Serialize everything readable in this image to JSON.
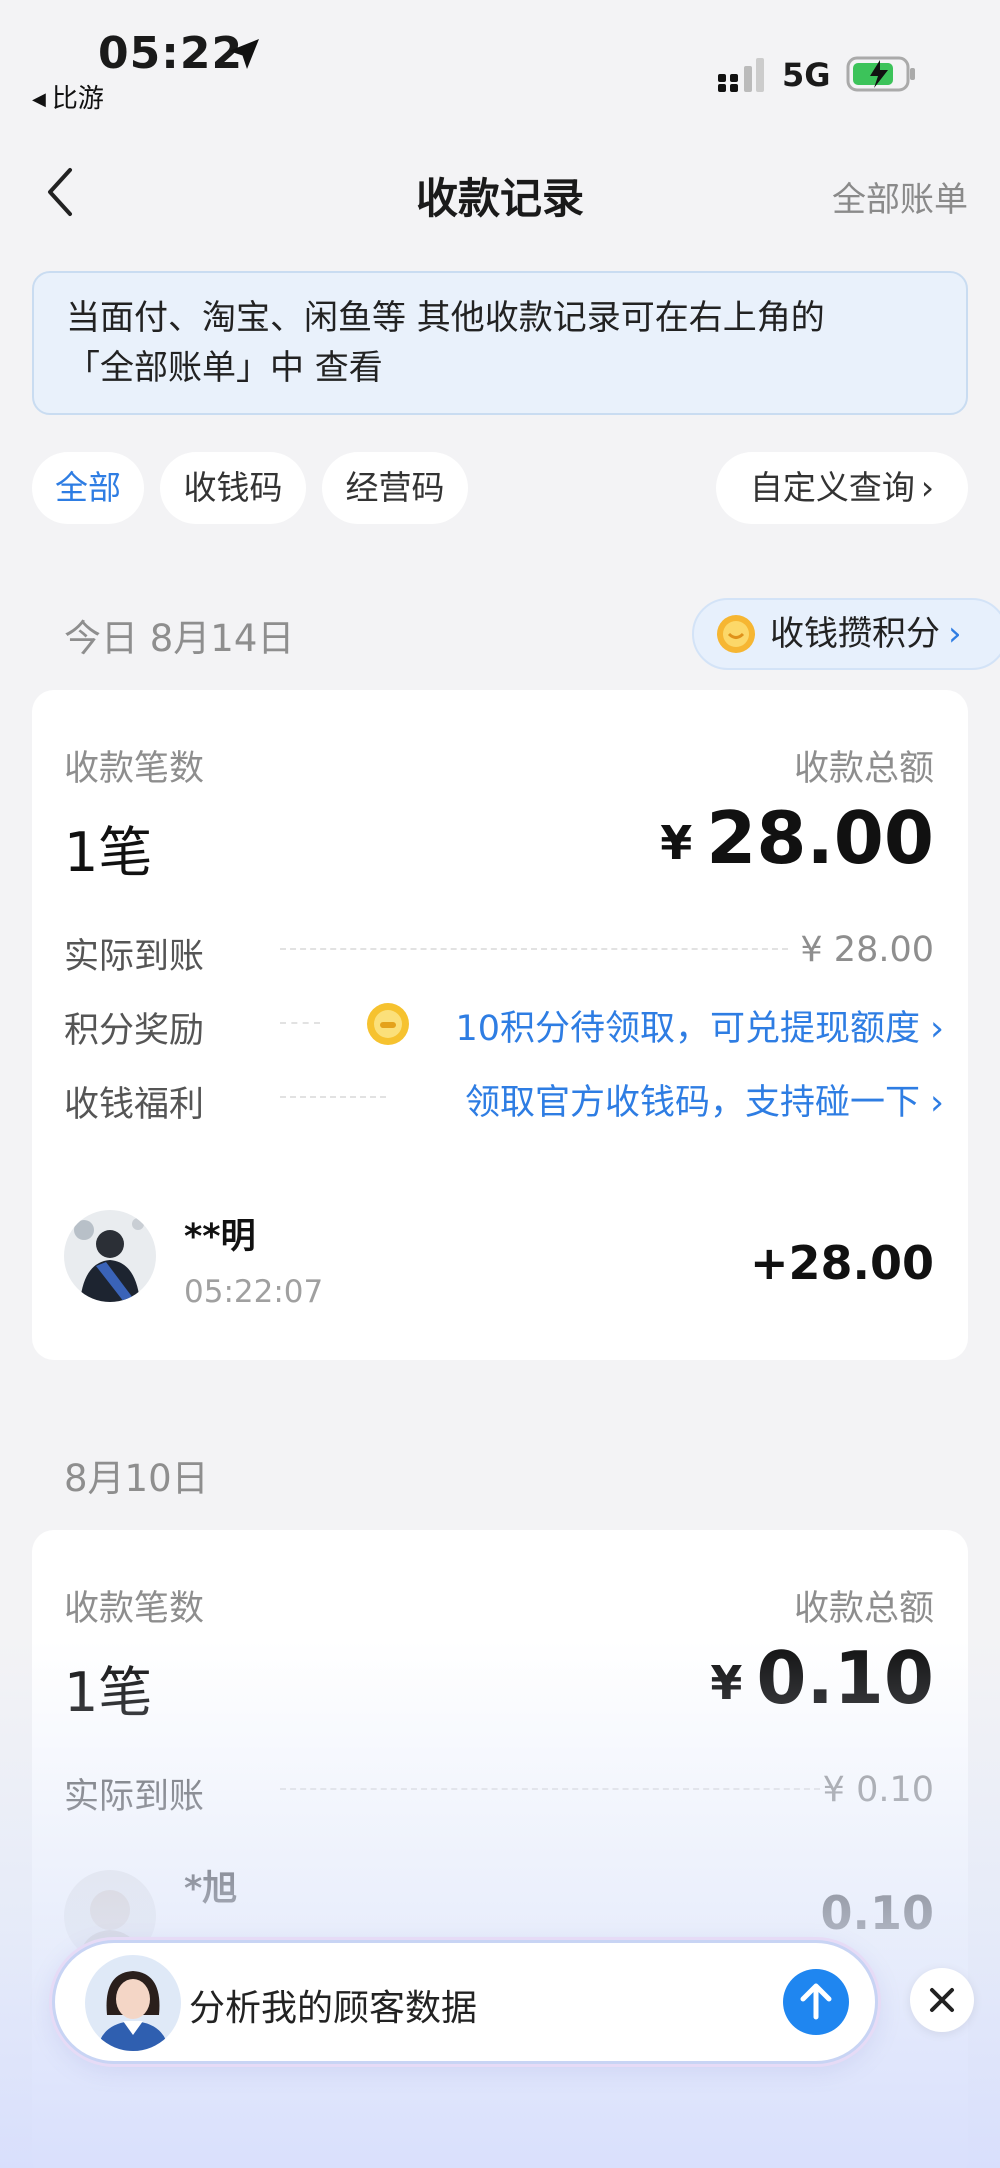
{
  "status_bar": {
    "time": "05:22",
    "back_app": "比游",
    "network": "5G"
  },
  "nav": {
    "title": "收款记录",
    "right_action": "全部账单"
  },
  "notice": {
    "line1": "当面付、淘宝、闲鱼等 其他收款记录可在右上角的",
    "line2": "「全部账单」中 查看"
  },
  "filters": {
    "all": "全部",
    "collect_code": "收钱码",
    "business_code": "经营码",
    "custom_query": "自定义查询"
  },
  "points_pill": "收钱攒积分",
  "groups": [
    {
      "date": "今日 8月14日",
      "count_label": "收款笔数",
      "total_label": "收款总额",
      "count": "1笔",
      "currency": "¥",
      "total": "28.00",
      "received_label": "实际到账",
      "received": "¥ 28.00",
      "reward_label": "积分奖励",
      "reward_text": "10积分待领取，可兑提现额度",
      "benefit_label": "收钱福利",
      "benefit_text": "领取官方收钱码，支持碰一下",
      "payer_name": "**明",
      "payer_time": "05:22:07",
      "amount": "+28.00"
    },
    {
      "date": "8月10日",
      "count_label": "收款笔数",
      "total_label": "收款总额",
      "count": "1笔",
      "currency": "¥",
      "total": "0.10",
      "received_label": "实际到账",
      "received": "¥ 0.10",
      "payer_name": "*旭",
      "amount": "0.10"
    }
  ],
  "ai_assistant": {
    "prompt": "分析我的顾客数据"
  },
  "colors": {
    "accent": "#2e7de3",
    "background": "#f3f3f5",
    "send_button": "#1f86f0"
  }
}
